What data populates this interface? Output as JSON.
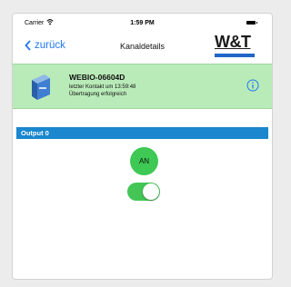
{
  "status_bar": {
    "carrier": "Carrier",
    "time": "1:59 PM"
  },
  "nav": {
    "back_label": "zurück",
    "title": "Kanaldetails",
    "logo_text": "W&T"
  },
  "device": {
    "name": "WEBIO-06604D",
    "last_contact": "letzter Kontakt um 13:59:48",
    "transfer_status": "Übertragung erfolgreich"
  },
  "section": {
    "title": "Output 0"
  },
  "output": {
    "button_label": "AN",
    "toggle_on": true
  },
  "colors": {
    "accent": "#1f78f0",
    "device_bg": "#b9ebb8",
    "section_bg": "#1a87cf",
    "on_green": "#3dc953"
  }
}
